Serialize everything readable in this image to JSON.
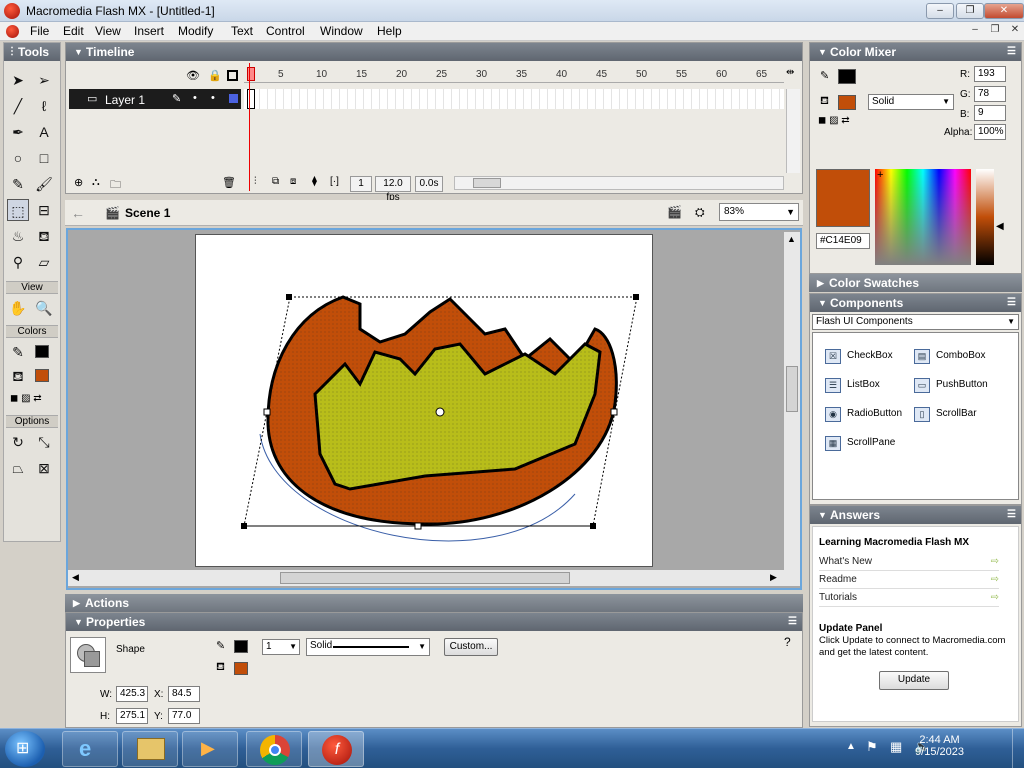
{
  "window": {
    "title": "Macromedia Flash MX - [Untitled-1]",
    "controls": {
      "minimize": "–",
      "maximize": "❐",
      "close": "✕"
    }
  },
  "menu": [
    "File",
    "Edit",
    "View",
    "Insert",
    "Modify",
    "Text",
    "Control",
    "Window",
    "Help"
  ],
  "tools": {
    "title": "Tools",
    "view_label": "View",
    "colors_label": "Colors",
    "options_label": "Options",
    "stroke_color": "#000000",
    "fill_color": "#C14E09"
  },
  "timeline": {
    "title": "Timeline",
    "frame_numbers": [
      "5",
      "10",
      "15",
      "20",
      "25",
      "30",
      "35",
      "40",
      "45",
      "50",
      "55",
      "60",
      "65"
    ],
    "layer_name": "Layer 1",
    "current_frame": "1",
    "fps": "12.0 fps",
    "time": "0.0s"
  },
  "editbar": {
    "scene": "Scene 1",
    "zoom": "83%"
  },
  "panels": {
    "actions": "Actions",
    "properties": "Properties",
    "color_mixer": "Color Mixer",
    "color_swatches": "Color Swatches",
    "components": "Components",
    "answers": "Answers"
  },
  "properties": {
    "type": "Shape",
    "stroke_width": "1",
    "stroke_style": "Solid",
    "custom_button": "Custom...",
    "w_label": "W:",
    "w_value": "425.3",
    "h_label": "H:",
    "h_value": "275.1",
    "x_label": "X:",
    "x_value": "84.5",
    "y_label": "Y:",
    "y_value": "77.0"
  },
  "color_mixer": {
    "r_label": "R:",
    "r_value": "193",
    "g_label": "G:",
    "g_value": "78",
    "b_label": "B:",
    "b_value": "9",
    "alpha_label": "Alpha:",
    "alpha_value": "100%",
    "fill_type": "Solid",
    "hex": "#C14E09",
    "color": "#C14E09"
  },
  "components": {
    "category": "Flash UI Components",
    "items": [
      "CheckBox",
      "ComboBox",
      "ListBox",
      "PushButton",
      "RadioButton",
      "ScrollBar",
      "ScrollPane"
    ]
  },
  "answers": {
    "heading": "Learning Macromedia Flash MX",
    "links": [
      "What's New",
      "Readme",
      "Tutorials"
    ],
    "update_title": "Update Panel",
    "update_text": "Click Update to connect to Macromedia.com and get the latest content.",
    "update_button": "Update"
  },
  "taskbar": {
    "time": "2:44 AM",
    "date": "9/15/2023"
  }
}
